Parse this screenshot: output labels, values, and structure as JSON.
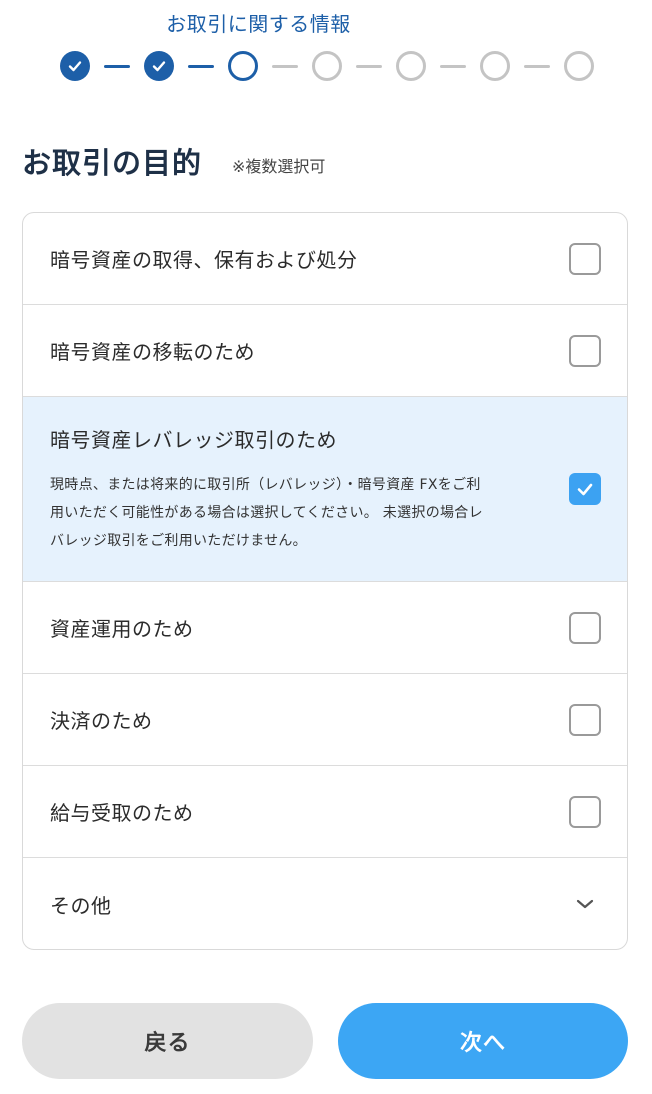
{
  "stepper": {
    "title": "お取引に関する情報",
    "steps": [
      "done",
      "done",
      "current",
      "todo",
      "todo",
      "todo",
      "todo"
    ],
    "colors": {
      "active": "#1d5fa8",
      "inactive": "#c4c4c4"
    }
  },
  "section": {
    "title": "お取引の目的",
    "note": "※複数選択可"
  },
  "options": [
    {
      "label": "暗号資産の取得、保有および処分",
      "checked": false
    },
    {
      "label": "暗号資産の移転のため",
      "checked": false
    },
    {
      "label": "暗号資産レバレッジ取引のため",
      "checked": true,
      "description": [
        "現時点、または将来的に取引所（レバレッジ）・暗号資産 FXをご利",
        "用いただく可能性がある場合は選択してください。 未選択の場合レ",
        "バレッジ取引をご利用いただけません。"
      ]
    },
    {
      "label": "資産運用のため",
      "checked": false
    },
    {
      "label": "決済のため",
      "checked": false
    },
    {
      "label": "給与受取のため",
      "checked": false
    },
    {
      "label": "その他",
      "icon": "chevron-down-icon"
    }
  ],
  "buttons": {
    "back": "戻る",
    "next": "次へ"
  },
  "colors": {
    "primary": "#3ca6f4",
    "selected_bg": "#e6f2fd",
    "heading": "#1e3047"
  }
}
